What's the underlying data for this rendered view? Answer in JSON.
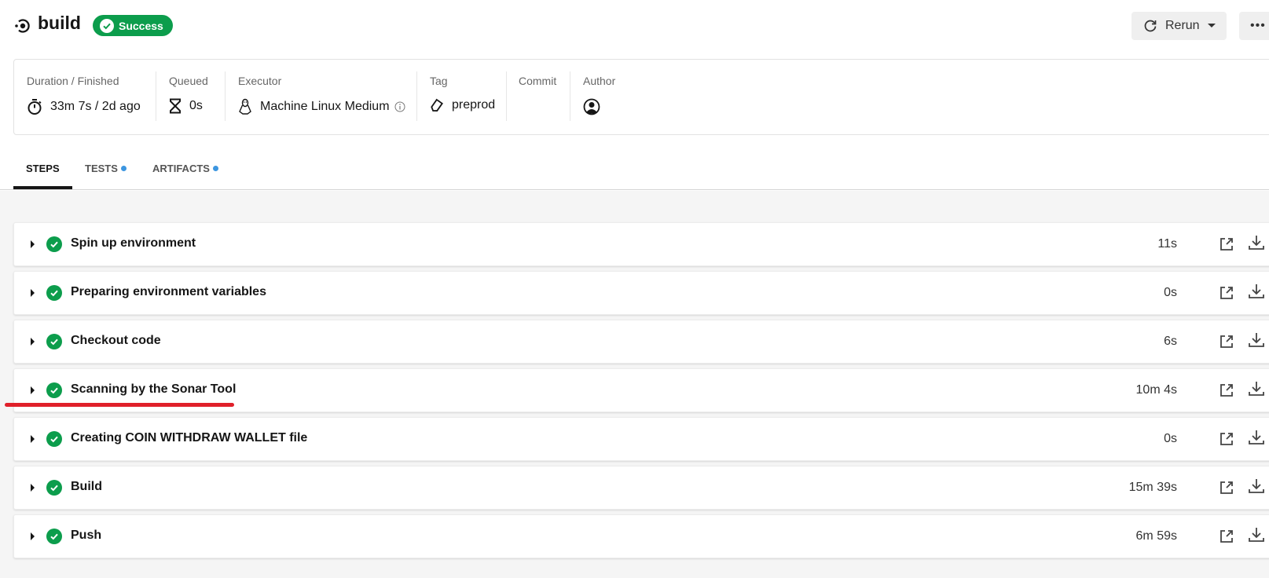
{
  "header": {
    "workflow_icon": "workflow-icon",
    "title": "build",
    "status_badge": {
      "label": "Success",
      "icon": "check-circle-icon",
      "color": "#0c9d4c"
    },
    "rerun_button": {
      "label": "Rerun",
      "icon": "refresh-icon",
      "caret_icon": "caret-down-icon"
    },
    "more_button": {
      "label": "•••",
      "icon": "more-icon"
    }
  },
  "info": {
    "duration": {
      "label": "Duration / Finished",
      "value": "33m 7s / 2d ago",
      "icon": "timer-icon"
    },
    "queued": {
      "label": "Queued",
      "value": "0s",
      "icon": "hourglass-icon"
    },
    "executor": {
      "label": "Executor",
      "value": "Machine Linux Medium",
      "icon": "linux-icon",
      "info_icon": "info-icon"
    },
    "tag": {
      "label": "Tag",
      "value": "preprod",
      "icon": "tag-icon"
    },
    "commit": {
      "label": "Commit",
      "value": ""
    },
    "author": {
      "label": "Author",
      "icon": "user-avatar-icon"
    }
  },
  "tabs": [
    {
      "label": "STEPS",
      "active": true,
      "dot": false
    },
    {
      "label": "TESTS",
      "active": false,
      "dot": true
    },
    {
      "label": "ARTIFACTS",
      "active": false,
      "dot": true
    }
  ],
  "colors": {
    "success": "#0c9d4c",
    "tab_dot": "#3d96e0",
    "annotation": "#e0202a"
  },
  "steps": [
    {
      "name": "Spin up environment",
      "duration": "11s",
      "status": "success"
    },
    {
      "name": "Preparing environment variables",
      "duration": "0s",
      "status": "success"
    },
    {
      "name": "Checkout code",
      "duration": "6s",
      "status": "success"
    },
    {
      "name": "Scanning by the Sonar Tool",
      "duration": "10m 4s",
      "status": "success",
      "highlighted": true
    },
    {
      "name": "Creating COIN WITHDRAW WALLET file",
      "duration": "0s",
      "status": "success"
    },
    {
      "name": "Build",
      "duration": "15m 39s",
      "status": "success"
    },
    {
      "name": "Push",
      "duration": "6m 59s",
      "status": "success"
    }
  ]
}
